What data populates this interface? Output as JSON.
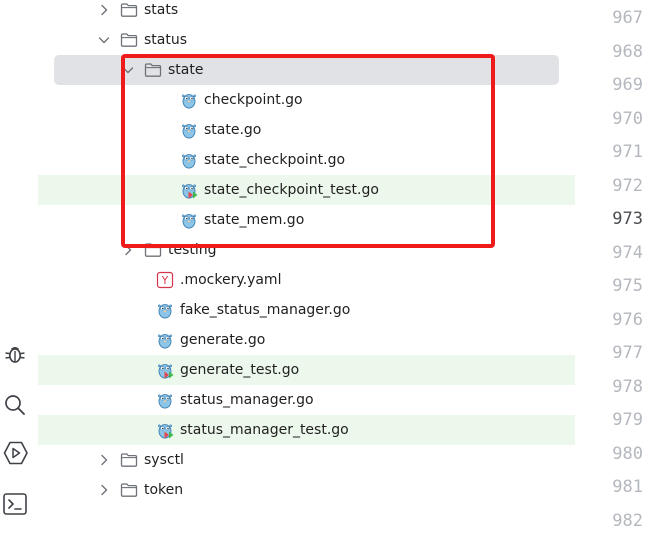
{
  "colors": {
    "highlight_border": "#ef1a1a",
    "selected_row": "#e1e2e5",
    "test_row": "#edf8ec",
    "line_number": "#b4b8be",
    "current_line_number": "#4a4d52"
  },
  "tool_strip": [
    {
      "name": "debug-icon"
    },
    {
      "name": "search-icon"
    },
    {
      "name": "services-icon"
    },
    {
      "name": "terminal-icon"
    }
  ],
  "tree": {
    "items": [
      {
        "label": "stats",
        "kind": "folder",
        "expanded": false
      },
      {
        "label": "status",
        "kind": "folder",
        "expanded": true
      },
      {
        "label": "state",
        "kind": "folder",
        "expanded": true,
        "selected": true
      },
      {
        "label": "checkpoint.go",
        "kind": "go"
      },
      {
        "label": "state.go",
        "kind": "go"
      },
      {
        "label": "state_checkpoint.go",
        "kind": "go"
      },
      {
        "label": "state_checkpoint_test.go",
        "kind": "go-test"
      },
      {
        "label": "state_mem.go",
        "kind": "go"
      },
      {
        "label": "testing",
        "kind": "folder",
        "expanded": false
      },
      {
        "label": ".mockery.yaml",
        "kind": "yaml"
      },
      {
        "label": "fake_status_manager.go",
        "kind": "go"
      },
      {
        "label": "generate.go",
        "kind": "go"
      },
      {
        "label": "generate_test.go",
        "kind": "go-test"
      },
      {
        "label": "status_manager.go",
        "kind": "go"
      },
      {
        "label": "status_manager_test.go",
        "kind": "go-test"
      },
      {
        "label": "sysctl",
        "kind": "folder",
        "expanded": false
      },
      {
        "label": "token",
        "kind": "folder",
        "expanded": false
      }
    ]
  },
  "line_numbers": {
    "numbers": [
      "967",
      "968",
      "969",
      "970",
      "971",
      "972",
      "973",
      "974",
      "975",
      "976",
      "977",
      "978",
      "979",
      "980",
      "981",
      "982"
    ],
    "current": "973"
  }
}
